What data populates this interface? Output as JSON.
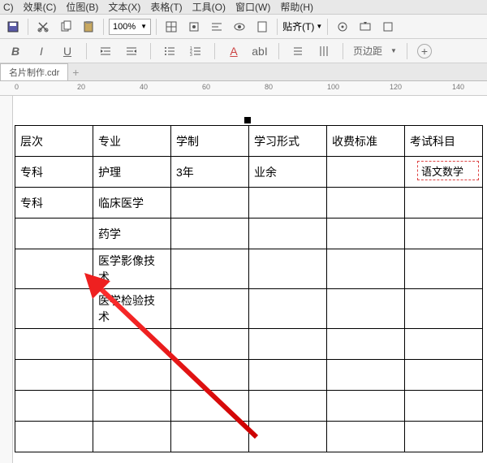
{
  "menu": {
    "items": [
      "C)",
      "效果(C)",
      "位图(B)",
      "文本(X)",
      "表格(T)",
      "工具(O)",
      "窗口(W)",
      "帮助(H)"
    ]
  },
  "toolbar": {
    "zoom": "100%",
    "paste_label": "贴齐(T)"
  },
  "toolbar2": {
    "page_margin": "页边距"
  },
  "tabs": {
    "active": "名片制作.cdr"
  },
  "ruler": {
    "ticks": [
      "0",
      "20",
      "40",
      "60",
      "80",
      "100",
      "120",
      "140"
    ]
  },
  "table": {
    "headers": [
      "层次",
      "专业",
      "学制",
      "学习形式",
      "收费标准",
      "考试科目"
    ],
    "rows": [
      [
        "专科",
        "护理",
        "3年",
        "业余",
        "",
        ""
      ],
      [
        "专科",
        "临床医学",
        "",
        "",
        "",
        ""
      ],
      [
        "",
        "药学",
        "",
        "",
        "",
        ""
      ],
      [
        "",
        "医学影像技术",
        "",
        "",
        "",
        ""
      ],
      [
        "",
        "医学检验技术",
        "",
        "",
        "",
        ""
      ],
      [
        "",
        "",
        "",
        "",
        "",
        ""
      ],
      [
        "",
        "",
        "",
        "",
        "",
        ""
      ],
      [
        "",
        "",
        "",
        "",
        "",
        ""
      ],
      [
        "",
        "",
        "",
        "",
        "",
        ""
      ]
    ],
    "dashed_cell": "语文数学"
  }
}
